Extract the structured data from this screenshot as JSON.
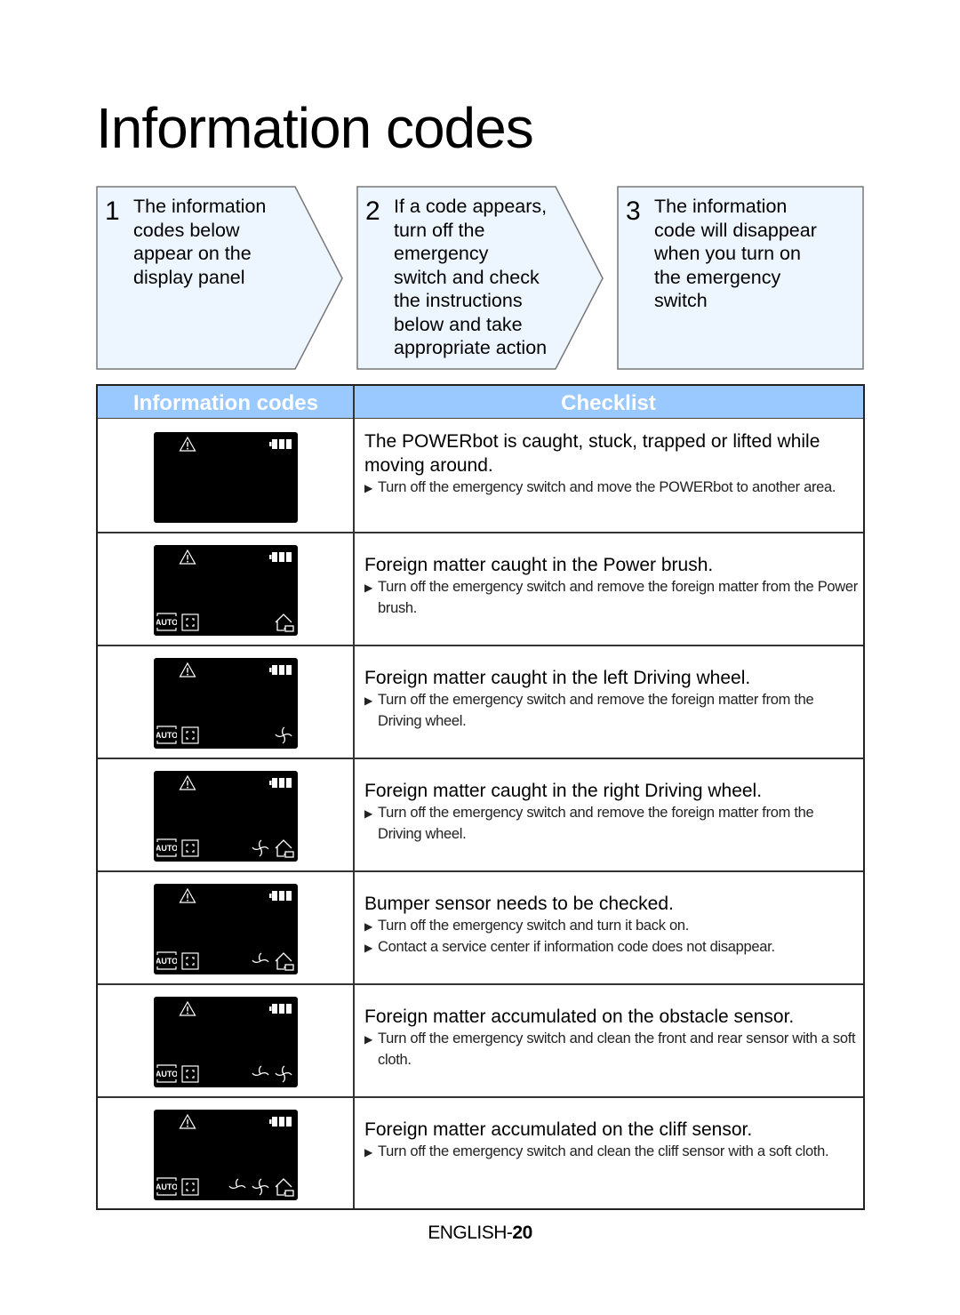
{
  "page": {
    "title": "Information codes",
    "footer_prefix": "ENGLISH-",
    "footer_page": "20"
  },
  "steps": [
    {
      "number": "1",
      "text": "The information\ncodes below\nappear on the\ndisplay panel"
    },
    {
      "number": "2",
      "text": "If a code appears,\nturn off the\nemergency\nswitch and check\nthe instructions\nbelow and take\nappropriate action"
    },
    {
      "number": "3",
      "text": "The information\ncode will disappear\nwhen you turn on\nthe emergency\nswitch"
    }
  ],
  "table": {
    "header_codes": "Information codes",
    "header_checklist": "Checklist",
    "colors": {
      "header_bg": "#99c9ff",
      "header_text": "#ffffff",
      "panel_bg": "#000000",
      "step_bg": "#edf6ff"
    },
    "rows": [
      {
        "display_icons": [
          "warning-icon",
          "battery-icon"
        ],
        "title": "The POWERbot is caught, stuck, trapped or lifted while moving around.",
        "items": [
          "Turn off the emergency switch and move the POWERbot to another area."
        ]
      },
      {
        "display_icons": [
          "warning-icon",
          "battery-icon",
          "auto-mode-icon",
          "spot-area-icon",
          "home-charge-icon"
        ],
        "title": "Foreign matter caught in the Power brush.",
        "items": [
          "Turn off the emergency switch and remove the foreign matter from the Power brush."
        ]
      },
      {
        "display_icons": [
          "warning-icon",
          "battery-icon",
          "auto-mode-icon",
          "spot-area-icon",
          "fan-icon"
        ],
        "title": "Foreign matter caught in the left Driving wheel.",
        "items": [
          "Turn off the emergency switch and remove the foreign matter from the Driving wheel."
        ]
      },
      {
        "display_icons": [
          "warning-icon",
          "battery-icon",
          "auto-mode-icon",
          "spot-area-icon",
          "fan-icon",
          "home-charge-icon"
        ],
        "title": "Foreign matter caught in the right Driving wheel.",
        "items": [
          "Turn off the emergency switch and remove the foreign matter from the Driving wheel."
        ]
      },
      {
        "display_icons": [
          "warning-icon",
          "battery-icon",
          "auto-mode-icon",
          "spot-area-icon",
          "half-fan-icon",
          "home-charge-icon"
        ],
        "title": "Bumper sensor needs to be checked.",
        "items": [
          "Turn off the emergency switch and turn it back on.",
          "Contact a service center if information code does not disappear."
        ]
      },
      {
        "display_icons": [
          "warning-icon",
          "battery-icon",
          "auto-mode-icon",
          "spot-area-icon",
          "half-fan-icon",
          "fan-icon"
        ],
        "title": "Foreign matter accumulated on the obstacle sensor.",
        "items": [
          "Turn off the emergency switch and clean the front and rear sensor with a soft cloth."
        ]
      },
      {
        "display_icons": [
          "warning-icon",
          "battery-icon",
          "auto-mode-icon",
          "spot-area-icon",
          "half-fan-icon",
          "fan-icon",
          "home-charge-icon"
        ],
        "title": "Foreign matter accumulated on the cliff sensor.",
        "items": [
          "Turn off the emergency switch and clean the cliff sensor with a soft cloth."
        ]
      }
    ],
    "auto_label": "AUTO",
    "bullet_glyph": "▶"
  }
}
